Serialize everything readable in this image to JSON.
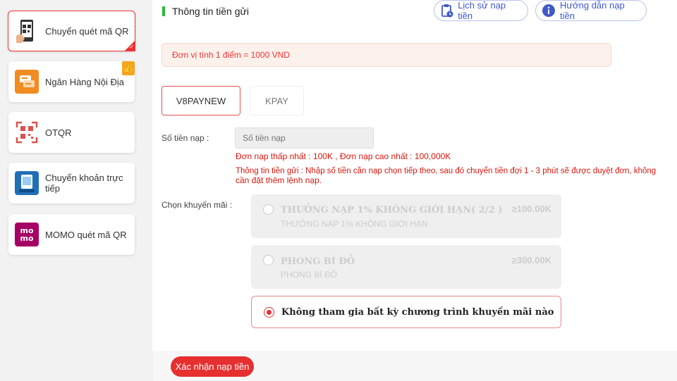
{
  "sidebar": {
    "items": [
      {
        "label": "Chuyển quét mã QR",
        "icon": "qr-phone-icon",
        "active": true
      },
      {
        "label": "Ngân Hàng Nội Địa",
        "icon": "bank-transfer-icon",
        "badge": "thumbs-up-icon"
      },
      {
        "label": "OTQR",
        "icon": "qr-code-icon"
      },
      {
        "label": "Chuyển khoản trực tiếp",
        "icon": "online-banking-icon"
      },
      {
        "label": "MOMO quét mã QR",
        "icon": "momo-icon"
      }
    ]
  },
  "header": {
    "title": "Thông tin tiền gửi",
    "history_label": "Lịch sử nạp tiền",
    "guide_label": "Hướng dẫn nạp tiền"
  },
  "notice": "Đơn vị tính 1 điểm = 1000 VND",
  "channels": [
    "V8PAYNEW",
    "KPAY"
  ],
  "amount": {
    "label": "Số tiền nạp :",
    "placeholder": "Số tiền nạp",
    "limits": "Đơn nạp thấp nhất : 100K , Đơn nạp cao nhất : 100,000K",
    "info_line1": "Thông tin tiền gửi : Nhập số tiền cần nạp chọn tiếp theo, sau đó chuyển tiền đợi 1 - 3 phút sẽ được duyệt đơn, không",
    "info_line2": "cần đặt thêm lệnh nạp."
  },
  "promotions": {
    "label": "Chọn khuyến mãi :",
    "items": [
      {
        "name": "THƯỞNG NẠP 1% KHÔNG GIỚI HẠN( 2/2 )",
        "sub": "THƯỞNG NẠP 1% KHÔNG GIỚI HẠN",
        "min": "≥100.00K",
        "disabled": true
      },
      {
        "name": "PHONG BÌ ĐỎ",
        "sub": "PHONG BÌ ĐỎ",
        "min": "≥300.00K",
        "disabled": true
      },
      {
        "name": "Không tham gia bất kỳ chương trình khuyến mãi nào",
        "selected": true
      }
    ]
  },
  "confirm_label": "Xác nhận nạp tiền",
  "colors": {
    "accent": "#e62f2f",
    "green": "#2dbb3a",
    "link": "#3f5ac8"
  }
}
